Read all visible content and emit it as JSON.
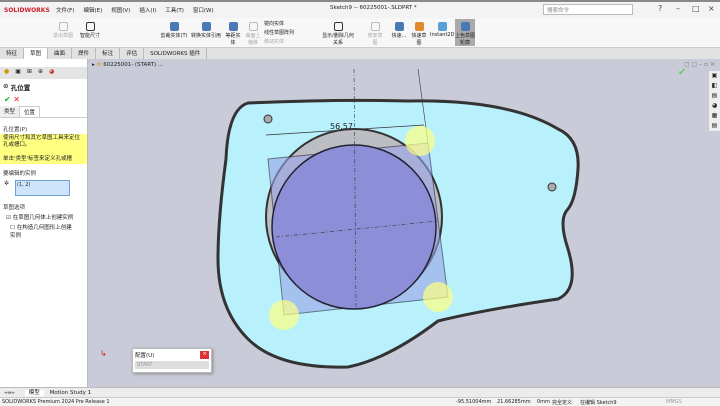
{
  "app": {
    "brand": "SOLIDWORKS",
    "document_title": "Sketch9 -- 60225001-.SLDPRT *",
    "search_placeholder": "搜索命令"
  },
  "menu": [
    "文件(F)",
    "编辑(E)",
    "视图(V)",
    "插入(I)",
    "工具(T)",
    "窗口(W)"
  ],
  "ribbon": {
    "exit_sketch": "退出草图",
    "smart_dim": "智能尺寸",
    "trim": "剪裁实体(T)",
    "convert": "转换实体引用",
    "offset": "等距实体",
    "surface_offset": "曲面上偏移",
    "mirror": "镜向实体",
    "linear_pattern": "线性草图阵列",
    "move": "移动实体",
    "relations": "显示/删除几何关系",
    "repair": "修复草图",
    "quick_snap": "快速...",
    "rapid_sketch": "快速草图",
    "instant2d": "Instant2D",
    "shaded_contours": "上色草图轮廓"
  },
  "tabs": [
    "特征",
    "草图",
    "曲面",
    "焊件",
    "标注",
    "评估",
    "SOLIDWORKS 插件"
  ],
  "tree_root": "60225001- (START) ...",
  "panel": {
    "title": "孔位置",
    "tab_type": "类型",
    "tab_position": "位置",
    "section_position": "孔位置(P)",
    "hint1": "使用尺寸和其它草图工具来定位孔或槽口。",
    "hint2": "单击'类型'标签来定义孔或槽",
    "section_instances": "要编辑的实例",
    "instances_value": "(1, 2)",
    "section_options": "草图选项",
    "opt1": "在草图几何体上创建实例",
    "opt2": "在构造几何图形上创建实例",
    "opt1_checked": true,
    "opt2_checked": false
  },
  "dimension": "56.57",
  "config_popup": {
    "title": "配置(U)",
    "value": "START"
  },
  "bottom_tabs": [
    "模型",
    "Motion Study 1"
  ],
  "status": {
    "version": "SOLIDWORKS Premium 2024 Pre Release 1",
    "x": "-95.51004mm",
    "y": "21.66285mm",
    "z": "0mm",
    "state": "完全定义",
    "editing": "在编辑 Sketch9",
    "units": "MMGS"
  },
  "colors": {
    "part_fill": "#b8f0fc",
    "circle_fill": "#8c8fd8",
    "viewport": "#c9ccd8",
    "highlight": "#ffff80"
  }
}
